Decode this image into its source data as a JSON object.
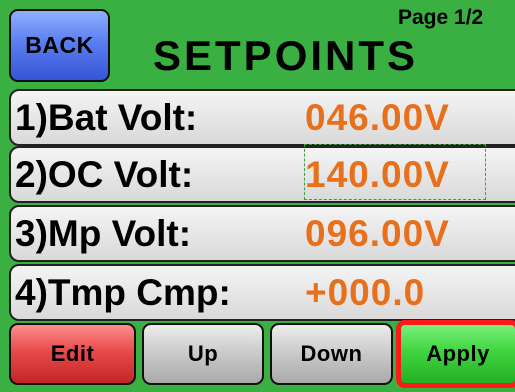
{
  "header": {
    "back_label": "BACK",
    "page_indicator": "Page 1/2",
    "title": "SETPOINTS"
  },
  "setpoints": [
    {
      "label": "1)Bat Volt:",
      "value": "046.00V"
    },
    {
      "label": "2)OC Volt:",
      "value": "140.00V"
    },
    {
      "label": "3)Mp Volt:",
      "value": "096.00V"
    },
    {
      "label": "4)Tmp Cmp:",
      "value": "+000.0"
    }
  ],
  "buttons": {
    "edit": "Edit",
    "up": "Up",
    "down": "Down",
    "apply": "Apply"
  },
  "colors": {
    "background": "#3bb042",
    "value_text": "#e8701c",
    "back_button": "#5a7ef0",
    "edit_button": "#e84a4a",
    "apply_button": "#3fd53f",
    "apply_highlight": "#ff1a1a"
  }
}
